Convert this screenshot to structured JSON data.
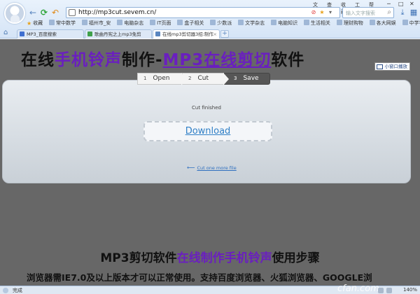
{
  "menu": [
    "文件",
    "查看",
    "收藏",
    "工具",
    "帮助"
  ],
  "address": {
    "url": "http://mp3cut.sevem.cn/"
  },
  "search": {
    "placeholder": "输入文字搜索"
  },
  "favorites": [
    {
      "label": "收藏",
      "icon": "star-icon"
    },
    {
      "label": "常中数学",
      "icon": "folder-icon"
    },
    {
      "label": "福州市_安",
      "icon": "folder-icon"
    },
    {
      "label": "电脑杂志",
      "icon": "folder-icon"
    },
    {
      "label": "IT页面",
      "icon": "folder-icon"
    },
    {
      "label": "盒子相关",
      "icon": "folder-icon"
    },
    {
      "label": "少数派",
      "icon": "folder-icon"
    },
    {
      "label": "文学杂志",
      "icon": "folder-icon"
    },
    {
      "label": "电脑知识",
      "icon": "folder-icon"
    },
    {
      "label": "生活相关",
      "icon": "folder-icon"
    },
    {
      "label": "理财购物",
      "icon": "folder-icon"
    },
    {
      "label": "各大网娱",
      "icon": "folder-icon"
    },
    {
      "label": "中学学",
      "icon": "folder-icon"
    }
  ],
  "tabs": [
    {
      "label": "MP3_百度搜索",
      "color": "#3f6fd0"
    },
    {
      "label": "歌曲丹宪之上mp3免剪",
      "color": "#3fa04a"
    },
    {
      "label": "在线mp3剪切器3招:制作",
      "color": "#5a86c0"
    }
  ],
  "page": {
    "title_pre": "在线",
    "title_hl1": "手机铃声",
    "title_mid": "制作-",
    "title_hl2": "MP3在线剪切",
    "title_post": "软件",
    "mini_player": "小窗口播放",
    "steps": [
      {
        "num": "1",
        "label": "Open"
      },
      {
        "num": "2",
        "label": "Cut"
      },
      {
        "num": "3",
        "label": "Save"
      }
    ],
    "status": "Cut finished",
    "download": "Download",
    "cut_again": "Cut one more file",
    "sub_pre": "MP3剪切软件",
    "sub_hl": "在线制作手机铃声",
    "sub_post": "使用步骤",
    "note": "浏览器需IE7.0及以上版本才可以正常使用。支持百度浏览器、火狐浏览器、GOOGLE浏"
  },
  "statusbar": {
    "text": "完成",
    "zoom": "140%",
    "watermark": "cfan.com"
  },
  "colors": {
    "accent_purple": "#6a1fbf",
    "page_bg": "#676767",
    "link_blue": "#2f7fc6"
  }
}
